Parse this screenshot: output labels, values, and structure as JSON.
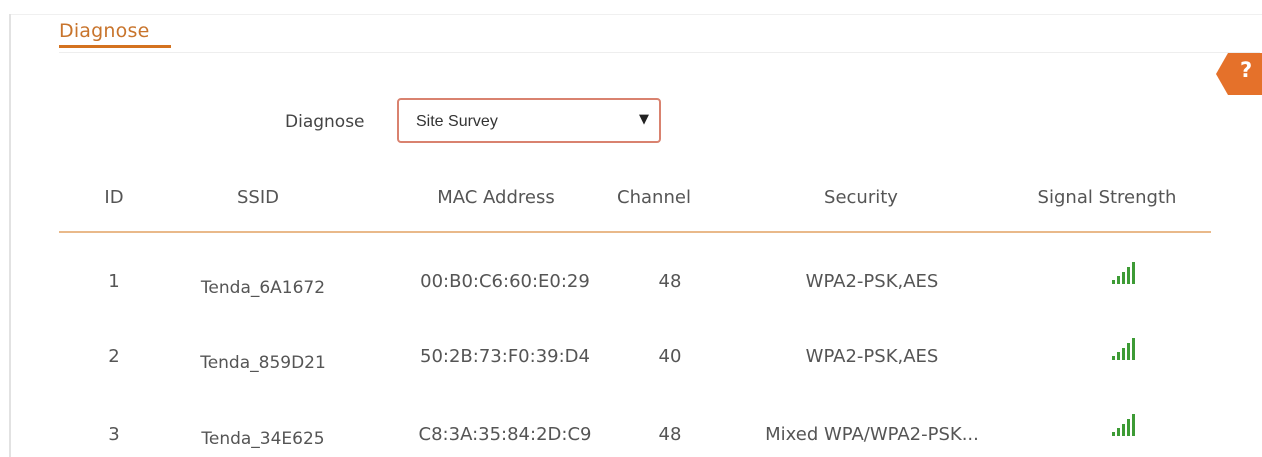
{
  "section": {
    "tab_label": "Diagnose"
  },
  "help": {
    "label": "?"
  },
  "form": {
    "diagnose_label": "Diagnose",
    "diagnose_select_value": "Site Survey",
    "arrow_glyph": "▼"
  },
  "table": {
    "columns": [
      "ID",
      "SSID",
      "MAC Address",
      "Channel",
      "Security",
      "Signal Strength"
    ],
    "rows": [
      {
        "id": "1",
        "ssid": "Tenda_6A1672",
        "mac": "00:B0:C6:60:E0:29",
        "channel": "48",
        "security": "WPA2-PSK,AES",
        "signal_level": 5
      },
      {
        "id": "2",
        "ssid": "Tenda_859D21",
        "mac": "50:2B:73:F0:39:D4",
        "channel": "40",
        "security": "WPA2-PSK,AES",
        "signal_level": 5
      },
      {
        "id": "3",
        "ssid": "Tenda_34E625",
        "mac": "C8:3A:35:84:2D:C9",
        "channel": "48",
        "security": "Mixed WPA/WPA2-PSK...",
        "signal_level": 5
      }
    ]
  },
  "colors": {
    "accent": "#d4721f",
    "help_tab": "#e5712a",
    "select_border": "#d9826f",
    "signal": "#3d9b35",
    "header_rule": "#e9b98a"
  }
}
